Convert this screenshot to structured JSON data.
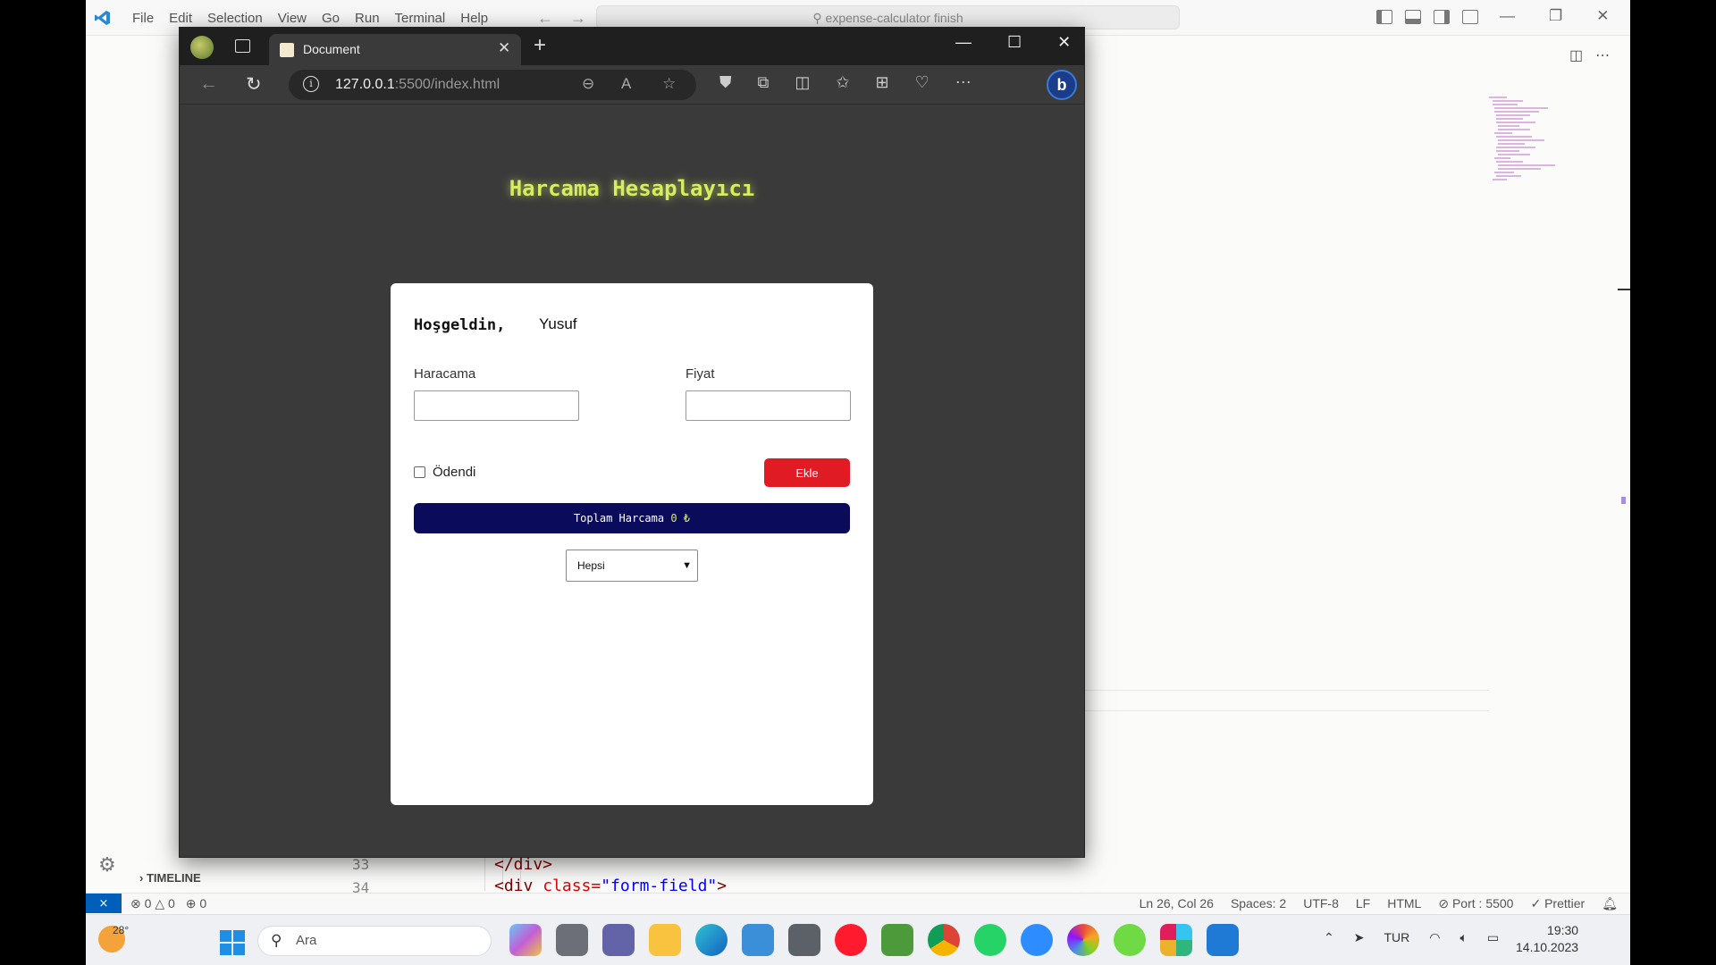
{
  "vscode": {
    "menu": [
      "File",
      "Edit",
      "Selection",
      "View",
      "Go",
      "Run",
      "Terminal",
      "Help"
    ],
    "search_text": "expense-calculator finish",
    "sidebar_section": "TIMELINE",
    "code_lines": [
      {
        "number": "33",
        "text": "</div>"
      },
      {
        "number": "34",
        "tag_open": "<div ",
        "attr": "class=",
        "value": "\"form-field\"",
        "tag_close": ">"
      }
    ],
    "status": {
      "errors": "0",
      "warnings": "0",
      "ports": "0",
      "position": "Ln 26, Col 26",
      "spaces": "Spaces: 2",
      "encoding": "UTF-8",
      "eol": "LF",
      "language": "HTML",
      "port": "Port : 5500",
      "formatter": "Prettier"
    }
  },
  "browser": {
    "tab_title": "Document",
    "url_host": "127.0.0.1",
    "url_path": ":5500/index.html"
  },
  "app": {
    "title": "Harcama Hesaplayıcı",
    "welcome": "Hoşgeldin,",
    "username": "Yusuf",
    "expense_label": "Haracama",
    "price_label": "Fiyat",
    "expense_value": "",
    "price_value": "",
    "paid_label": "Ödendi",
    "paid_checked": false,
    "add_button": "Ekle",
    "total_label": "Toplam Harcama",
    "total_amount": "0 ₺",
    "filter_selected": "Hepsi"
  },
  "taskbar": {
    "temperature": "28°",
    "search_placeholder": "Ara",
    "language": "TUR",
    "time": "19:30",
    "date": "14.10.2023"
  },
  "colors": {
    "accent_title": "#d6ec61",
    "add_button": "#e01b24",
    "total_bar": "#0b0b5c",
    "vscode_remote": "#005fb8"
  }
}
